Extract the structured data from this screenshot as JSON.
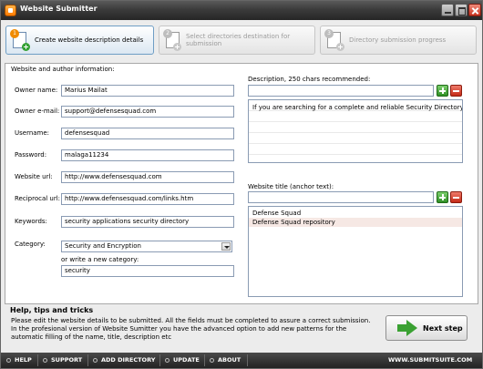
{
  "window": {
    "title": "Website Submitter"
  },
  "steps": [
    {
      "number": "1",
      "label": "Create website description details",
      "active": true
    },
    {
      "number": "2",
      "label": "Select directories destination for submission",
      "active": false
    },
    {
      "number": "3",
      "label": "Directory submission progress",
      "active": false
    }
  ],
  "form": {
    "legend": "Website and author information:",
    "owner_name": {
      "label": "Owner name:",
      "value": "Marius Mailat"
    },
    "owner_email": {
      "label": "Owner e-mail:",
      "value": "support@defensesquad.com"
    },
    "username": {
      "label": "Username:",
      "value": "defensesquad"
    },
    "password": {
      "label": "Password:",
      "value": "malaga11234"
    },
    "website_url": {
      "label": "Website url:",
      "value": "http://www.defensesquad.com"
    },
    "reciprocal_url": {
      "label": "Reciprocal url:",
      "value": "http://www.defensesquad.com/links.htm"
    },
    "keywords": {
      "label": "Keywords:",
      "value": "security applications security directory"
    },
    "category": {
      "label": "Category:",
      "value": "Security and Encryption"
    },
    "new_category": {
      "label": "or write a new category:",
      "value": "security"
    }
  },
  "description": {
    "label": "Description, 250 chars recommended:",
    "input_value": "",
    "items": [
      "If you are searching for a complete and reliable Security Directory, look ..."
    ]
  },
  "anchor": {
    "label": "Website title (anchor text):",
    "input_value": "",
    "items": [
      "Defense Squad",
      "Defense Squad repository"
    ]
  },
  "help": {
    "title": "Help, tips and tricks",
    "text": "Please edit the website details to be submitted. All the fields must be completed to assure a correct submission. In the profesional version of Website Sumitter you have the advanced option to add new patterns for the automatic filling of the name, title, description etc",
    "next_label": "Next step"
  },
  "footer": {
    "items": [
      "HELP",
      "SUPPORT",
      "ADD DIRECTORY",
      "UPDATE",
      "ABOUT"
    ],
    "site": "WWW.SUBMITSUITE.COM"
  },
  "colors": {
    "accent_orange": "#f08a00",
    "add_green": "#35a135",
    "remove_red": "#c42a17",
    "footer_bg": "#2b2b2b"
  }
}
